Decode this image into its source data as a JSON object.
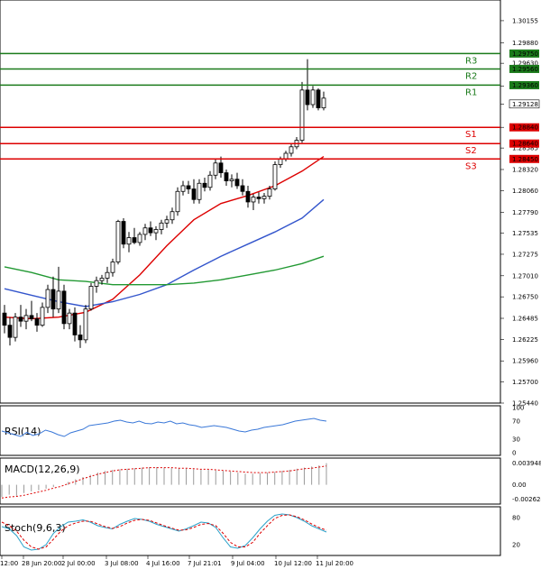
{
  "chart_data": {
    "type": "candlestick",
    "y_axis_ticks": [
      "1.30155",
      "1.29880",
      "1.29630",
      "1.29350",
      "1.29128",
      "1.28840",
      "1.28585",
      "1.28320",
      "1.28060",
      "1.27790",
      "1.27535",
      "1.27275",
      "1.27010",
      "1.26750",
      "1.26485",
      "1.26225",
      "1.25960",
      "1.25700",
      "1.25440"
    ],
    "ylim": [
      1.2544,
      1.3041
    ],
    "x_labels": [
      "12:00",
      "28 Jun 20:00",
      "2 Jul 00:00",
      "3 Jul 08:00",
      "4 Jul 16:00",
      "7 Jul 21:01",
      "9 Jul 04:00",
      "10 Jul 12:00",
      "11 Jul 20:00"
    ],
    "current_price": {
      "value": 1.29128,
      "label": "1.29128"
    },
    "levels": [
      {
        "name": "R3",
        "value": 1.2975,
        "label": "1.29750",
        "color": "#1a7a1a"
      },
      {
        "name": "R2",
        "value": 1.2956,
        "label": "1.29560",
        "color": "#1a7a1a"
      },
      {
        "name": "R1",
        "value": 1.2936,
        "label": "1.29360",
        "color": "#1a7a1a"
      },
      {
        "name": "S1",
        "value": 1.2884,
        "label": "1.28840",
        "color": "#dd0000"
      },
      {
        "name": "S2",
        "value": 1.2864,
        "label": "1.28640",
        "color": "#dd0000"
      },
      {
        "name": "S3",
        "value": 1.2845,
        "label": "1.28450",
        "color": "#dd0000"
      }
    ],
    "candles": [
      [
        1.2655,
        1.2665,
        1.263,
        1.264
      ],
      [
        1.264,
        1.265,
        1.2615,
        1.2625
      ],
      [
        1.2625,
        1.2655,
        1.262,
        1.265
      ],
      [
        1.265,
        1.2665,
        1.2638,
        1.2645
      ],
      [
        1.2645,
        1.266,
        1.2635,
        1.2652
      ],
      [
        1.2652,
        1.267,
        1.2645,
        1.2648
      ],
      [
        1.2648,
        1.2655,
        1.2632,
        1.264
      ],
      [
        1.264,
        1.2668,
        1.2638,
        1.2662
      ],
      [
        1.2662,
        1.269,
        1.2655,
        1.2684
      ],
      [
        1.2684,
        1.27,
        1.265,
        1.266
      ],
      [
        1.266,
        1.2712,
        1.2655,
        1.2682
      ],
      [
        1.2682,
        1.269,
        1.2635,
        1.2642
      ],
      [
        1.2642,
        1.266,
        1.2635,
        1.2655
      ],
      [
        1.2655,
        1.2662,
        1.262,
        1.2628
      ],
      [
        1.2628,
        1.264,
        1.2612,
        1.2622
      ],
      [
        1.2622,
        1.2665,
        1.2618,
        1.266
      ],
      [
        1.266,
        1.2692,
        1.2658,
        1.2688
      ],
      [
        1.2688,
        1.27,
        1.268,
        1.2695
      ],
      [
        1.2695,
        1.2702,
        1.269,
        1.2698
      ],
      [
        1.2698,
        1.2712,
        1.2692,
        1.2705
      ],
      [
        1.2705,
        1.2722,
        1.27,
        1.2718
      ],
      [
        1.2718,
        1.277,
        1.2715,
        1.2768
      ],
      [
        1.2768,
        1.2772,
        1.2735,
        1.274
      ],
      [
        1.274,
        1.2755,
        1.273,
        1.2748
      ],
      [
        1.2748,
        1.276,
        1.274,
        1.2742
      ],
      [
        1.2742,
        1.2755,
        1.2738,
        1.2752
      ],
      [
        1.2752,
        1.2765,
        1.2745,
        1.276
      ],
      [
        1.276,
        1.2768,
        1.275,
        1.2754
      ],
      [
        1.2754,
        1.2762,
        1.2745,
        1.2758
      ],
      [
        1.2758,
        1.277,
        1.2752,
        1.2766
      ],
      [
        1.2766,
        1.2775,
        1.276,
        1.277
      ],
      [
        1.277,
        1.2785,
        1.2765,
        1.278
      ],
      [
        1.278,
        1.281,
        1.2775,
        1.2805
      ],
      [
        1.2805,
        1.2818,
        1.28,
        1.2812
      ],
      [
        1.2812,
        1.2818,
        1.2802,
        1.2808
      ],
      [
        1.2808,
        1.282,
        1.279,
        1.2795
      ],
      [
        1.2795,
        1.282,
        1.279,
        1.2815
      ],
      [
        1.2815,
        1.2822,
        1.2805,
        1.281
      ],
      [
        1.281,
        1.283,
        1.2806,
        1.2825
      ],
      [
        1.2825,
        1.2845,
        1.282,
        1.284
      ],
      [
        1.284,
        1.2848,
        1.2822,
        1.2828
      ],
      [
        1.2828,
        1.2832,
        1.2812,
        1.2818
      ],
      [
        1.2818,
        1.2826,
        1.281,
        1.282
      ],
      [
        1.282,
        1.2828,
        1.2808,
        1.2812
      ],
      [
        1.2812,
        1.282,
        1.28,
        1.2805
      ],
      [
        1.2805,
        1.2812,
        1.2785,
        1.2792
      ],
      [
        1.2792,
        1.2802,
        1.2782,
        1.2798
      ],
      [
        1.2798,
        1.2804,
        1.279,
        1.2796
      ],
      [
        1.2796,
        1.2803,
        1.279,
        1.2799
      ],
      [
        1.2799,
        1.2812,
        1.2795,
        1.2808
      ],
      [
        1.2808,
        1.2842,
        1.2806,
        1.2838
      ],
      [
        1.2838,
        1.2848,
        1.2834,
        1.2845
      ],
      [
        1.2845,
        1.2855,
        1.2842,
        1.2852
      ],
      [
        1.2852,
        1.2864,
        1.2848,
        1.286
      ],
      [
        1.286,
        1.2872,
        1.2857,
        1.2868
      ],
      [
        1.2868,
        1.294,
        1.2865,
        1.293
      ],
      [
        1.293,
        1.2968,
        1.2905,
        1.2912
      ],
      [
        1.2912,
        1.2935,
        1.2908,
        1.293
      ],
      [
        1.293,
        1.2932,
        1.2905,
        1.2908
      ],
      [
        1.2908,
        1.2928,
        1.2905,
        1.292
      ]
    ],
    "moving_averages": [
      {
        "color": "#dd0000",
        "points": [
          [
            0,
            1.265
          ],
          [
            5,
            1.2648
          ],
          [
            10,
            1.265
          ],
          [
            15,
            1.2656
          ],
          [
            20,
            1.2672
          ],
          [
            25,
            1.2702
          ],
          [
            30,
            1.2738
          ],
          [
            35,
            1.277
          ],
          [
            40,
            1.279
          ],
          [
            45,
            1.28
          ],
          [
            50,
            1.2812
          ],
          [
            55,
            1.283
          ],
          [
            59,
            1.2848
          ]
        ]
      },
      {
        "color": "#3355cc",
        "points": [
          [
            0,
            1.2685
          ],
          [
            5,
            1.2677
          ],
          [
            10,
            1.2669
          ],
          [
            15,
            1.2663
          ],
          [
            20,
            1.2669
          ],
          [
            25,
            1.2678
          ],
          [
            30,
            1.269
          ],
          [
            35,
            1.2708
          ],
          [
            40,
            1.2725
          ],
          [
            45,
            1.274
          ],
          [
            50,
            1.2755
          ],
          [
            55,
            1.2772
          ],
          [
            59,
            1.2795
          ]
        ]
      },
      {
        "color": "#229933",
        "points": [
          [
            0,
            1.2712
          ],
          [
            5,
            1.2705
          ],
          [
            10,
            1.2696
          ],
          [
            15,
            1.2694
          ],
          [
            20,
            1.269
          ],
          [
            25,
            1.269
          ],
          [
            30,
            1.269
          ],
          [
            35,
            1.2692
          ],
          [
            40,
            1.2696
          ],
          [
            45,
            1.2702
          ],
          [
            50,
            1.2708
          ],
          [
            55,
            1.2716
          ],
          [
            59,
            1.2725
          ]
        ]
      }
    ],
    "indicators": {
      "rsi": {
        "title": "RSI(14)",
        "ticks": [
          "100",
          "70",
          "30",
          "0"
        ],
        "ylim": [
          0,
          100
        ],
        "values": [
          48,
          44,
          40,
          36,
          45,
          38,
          42,
          50,
          46,
          40,
          36,
          44,
          48,
          52,
          60,
          62,
          64,
          66,
          70,
          72,
          68,
          66,
          70,
          65,
          64,
          68,
          66,
          70,
          64,
          66,
          62,
          60,
          56,
          58,
          60,
          58,
          56,
          52,
          48,
          46,
          50,
          52,
          56,
          58,
          60,
          62,
          66,
          70,
          72,
          74,
          76,
          72,
          70
        ]
      },
      "macd": {
        "title": "MACD(12,26,9)",
        "ticks": [
          "0.003948",
          "0.00",
          "-0.002624"
        ],
        "ylim": [
          -0.003,
          0.0045
        ],
        "histogram": [
          -0.0022,
          -0.0018,
          -0.002,
          -0.0015,
          -0.0012,
          -0.001,
          -0.0007,
          -0.0004,
          0.0,
          0.0005,
          0.001,
          0.0014,
          0.0018,
          0.0022,
          0.0025,
          0.0027,
          0.0028,
          0.0029,
          0.003,
          0.0031,
          0.0032,
          0.0032,
          0.0031,
          0.003,
          0.003,
          0.0029,
          0.0028,
          0.0027,
          0.0027,
          0.0026,
          0.0025,
          0.0024,
          0.0022,
          0.002,
          0.002,
          0.0021,
          0.0022,
          0.0023,
          0.0025,
          0.0027,
          0.0029,
          0.0031,
          0.0033,
          0.0035,
          0.0039
        ],
        "signal": [
          -0.0024,
          -0.0022,
          -0.0021,
          -0.0019,
          -0.0016,
          -0.0013,
          -0.001,
          -0.0006,
          -0.0003,
          0.0002,
          0.0006,
          0.0011,
          0.0015,
          0.0019,
          0.0022,
          0.0025,
          0.0027,
          0.0028,
          0.0029,
          0.003,
          0.0031,
          0.0031,
          0.0031,
          0.0031,
          0.003,
          0.003,
          0.0029,
          0.0028,
          0.0028,
          0.0027,
          0.0026,
          0.0025,
          0.0024,
          0.0023,
          0.0022,
          0.0022,
          0.0022,
          0.0023,
          0.0024,
          0.0025,
          0.0027,
          0.0029,
          0.003,
          0.0032,
          0.0034
        ]
      },
      "stoch": {
        "title": "Stoch(9,6,3)",
        "ticks": [
          "80",
          "20"
        ],
        "ylim": [
          0,
          100
        ],
        "main": [
          60,
          55,
          40,
          15,
          8,
          10,
          20,
          45,
          60,
          70,
          72,
          75,
          70,
          62,
          58,
          55,
          65,
          72,
          78,
          76,
          72,
          65,
          60,
          55,
          50,
          55,
          62,
          70,
          68,
          58,
          35,
          15,
          12,
          18,
          35,
          55,
          72,
          85,
          88,
          86,
          80,
          72,
          62,
          55,
          48
        ],
        "signal": [
          70,
          62,
          50,
          30,
          15,
          10,
          15,
          32,
          50,
          62,
          68,
          72,
          72,
          66,
          60,
          56,
          60,
          68,
          74,
          76,
          74,
          68,
          62,
          57,
          52,
          53,
          58,
          65,
          67,
          62,
          45,
          25,
          15,
          15,
          25,
          45,
          62,
          78,
          85,
          86,
          82,
          75,
          66,
          58,
          52
        ]
      }
    }
  }
}
